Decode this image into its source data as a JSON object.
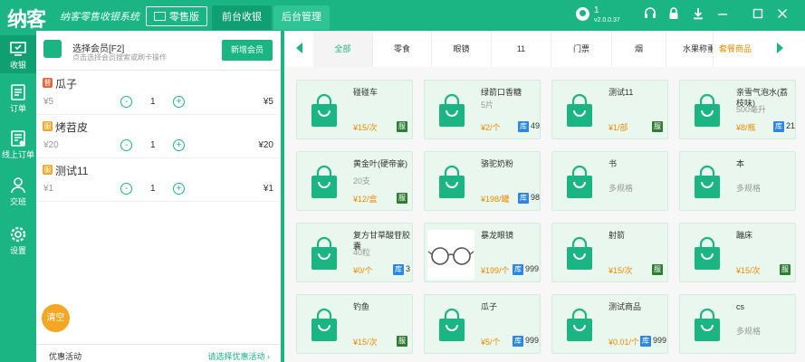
{
  "app": {
    "logo": "纳客",
    "slogan": "纳客零售收银系统"
  },
  "header": {
    "cashier_label": "零售版",
    "tab_front": "前台收银",
    "tab_back": "后台管理",
    "user_name": "1",
    "version": "v2.0.0.37"
  },
  "sidebar": {
    "items": [
      {
        "label": "收银",
        "icon": "cashier-icon"
      },
      {
        "label": "订单",
        "icon": "order-icon"
      },
      {
        "label": "线上订单",
        "icon": "online-order-icon"
      },
      {
        "label": "交班",
        "icon": "handover-icon"
      },
      {
        "label": "设置",
        "icon": "settings-icon"
      }
    ]
  },
  "member": {
    "title": "选择会员[F2]",
    "subtitle": "点击选择会员搜索或刷卡操作",
    "add_button": "新增会员"
  },
  "order_lines": [
    {
      "tag": "普",
      "tag_color": "#e8643c",
      "name": "瓜子",
      "price": "¥5",
      "qty": "1",
      "total": "¥5"
    },
    {
      "tag": "服",
      "tag_color": "#f5a623",
      "name": "烤苕皮",
      "price": "¥20",
      "qty": "1",
      "total": "¥20"
    },
    {
      "tag": "服",
      "tag_color": "#f5a623",
      "name": "测试11",
      "price": "¥1",
      "qty": "1",
      "total": "¥1"
    }
  ],
  "controls": {
    "minus": "-",
    "plus": "+"
  },
  "clear_button": "清空",
  "promo": {
    "label": "优惠活动",
    "action": "请选择优惠活动 ›"
  },
  "categories": [
    "全部",
    "零食",
    "眼镜",
    "11",
    "门票",
    "烟",
    "水果称重",
    "套餐商品"
  ],
  "goods": [
    {
      "name": "碰碰车",
      "sub": "",
      "price": "¥15/次",
      "badge": "服",
      "stock": ""
    },
    {
      "name": "绿箭口香糖",
      "sub": "5片",
      "price": "¥2/个",
      "badge": "库",
      "stock": "49"
    },
    {
      "name": "测试11",
      "sub": "",
      "price": "¥1/部",
      "badge": "服",
      "stock": ""
    },
    {
      "name": "亲雪气泡水(荔枝味)",
      "sub": "500毫升",
      "price": "¥8/瓶",
      "badge": "库",
      "stock": "21"
    },
    {
      "name": "黄金叶(硬帝豪)",
      "sub": "20支",
      "price": "¥12/盒",
      "badge": "服",
      "stock": ""
    },
    {
      "name": "骆驼奶粉",
      "sub": "",
      "price": "¥198/罐",
      "badge": "库",
      "stock": "98"
    },
    {
      "name": "书",
      "sub": "多规格",
      "price": "",
      "badge": "",
      "stock": ""
    },
    {
      "name": "本",
      "sub": "多规格",
      "price": "",
      "badge": "",
      "stock": ""
    },
    {
      "name": "复方甘草酸苷胶囊",
      "sub": "40粒",
      "price": "¥0/个",
      "badge": "库",
      "stock": "3"
    },
    {
      "name": "暴龙眼镜",
      "sub": "",
      "price": "¥199/个",
      "badge": "库",
      "stock": "999",
      "photo": true
    },
    {
      "name": "射箭",
      "sub": "",
      "price": "¥15/次",
      "badge": "服",
      "stock": ""
    },
    {
      "name": "蹦床",
      "sub": "",
      "price": "¥15/次",
      "badge": "服",
      "stock": ""
    },
    {
      "name": "钓鱼",
      "sub": "",
      "price": "¥15/次",
      "badge": "服",
      "stock": ""
    },
    {
      "name": "瓜子",
      "sub": "",
      "price": "¥5/个",
      "badge": "库",
      "stock": "999"
    },
    {
      "name": "测试商品",
      "sub": "",
      "price": "¥0.01/个",
      "badge": "库",
      "stock": "999"
    },
    {
      "name": "cs",
      "sub": "多规格",
      "price": "",
      "badge": "",
      "stock": ""
    }
  ],
  "colors": {
    "accent": "#1bb584",
    "price": "#f08c00",
    "service_badge": "#2e7d32",
    "stock_badge": "#2e86de"
  }
}
